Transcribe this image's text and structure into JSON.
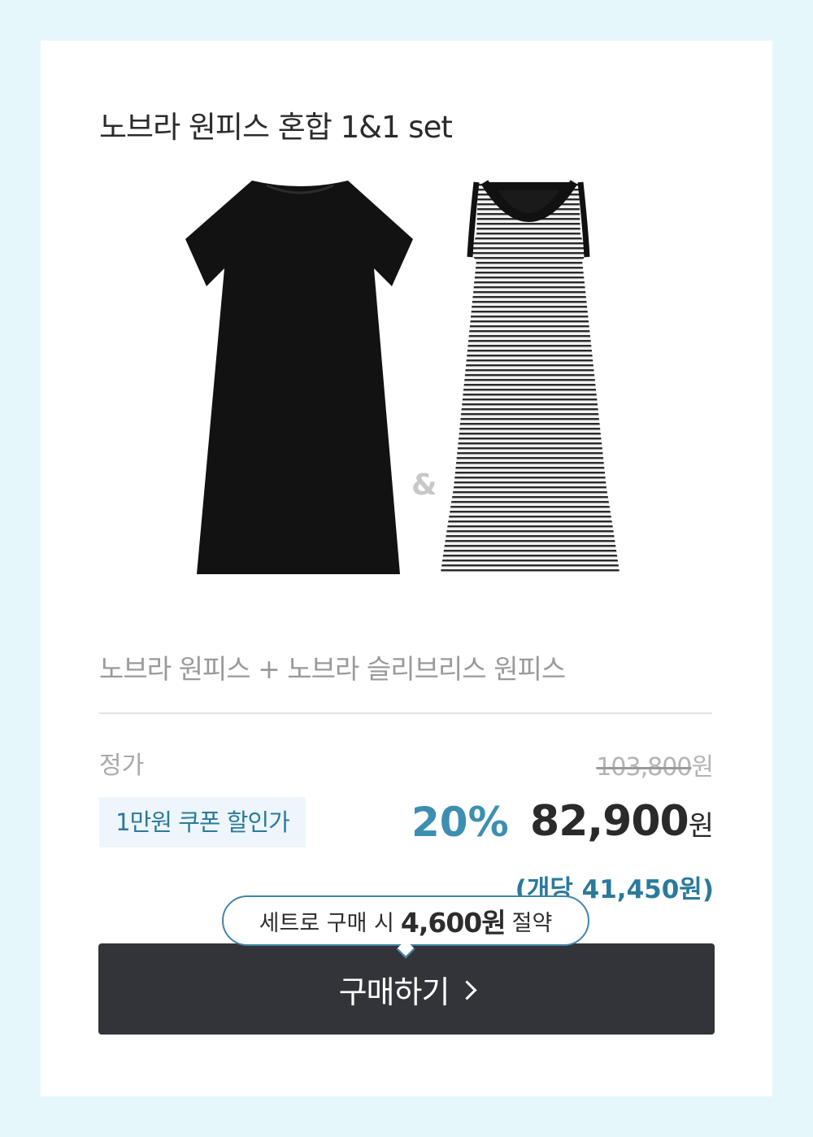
{
  "product": {
    "title": "노브라 원피스 혼합 1&1 set",
    "ampersand": "&",
    "subtitle": "노브라 원피스 + 노브라 슬리브리스 원피스"
  },
  "pricing": {
    "regular_label": "정가",
    "regular_price": "103,800",
    "currency": "원",
    "coupon_label": "1만원 쿠폰 할인가",
    "discount_rate": "20%",
    "sale_price": "82,900",
    "unit_price": "(개당 41,450원)"
  },
  "savings": {
    "prefix": "세트로 구매 시",
    "amount": "4,600원",
    "suffix": "절약"
  },
  "cta": {
    "buy_label": "구매하기"
  },
  "images": {
    "left_icon": "black-tshirt-dress",
    "right_icon": "striped-sleeveless-dress"
  },
  "colors": {
    "background": "#e6f7fc",
    "accent": "#3d8fb2",
    "button": "#333439"
  }
}
